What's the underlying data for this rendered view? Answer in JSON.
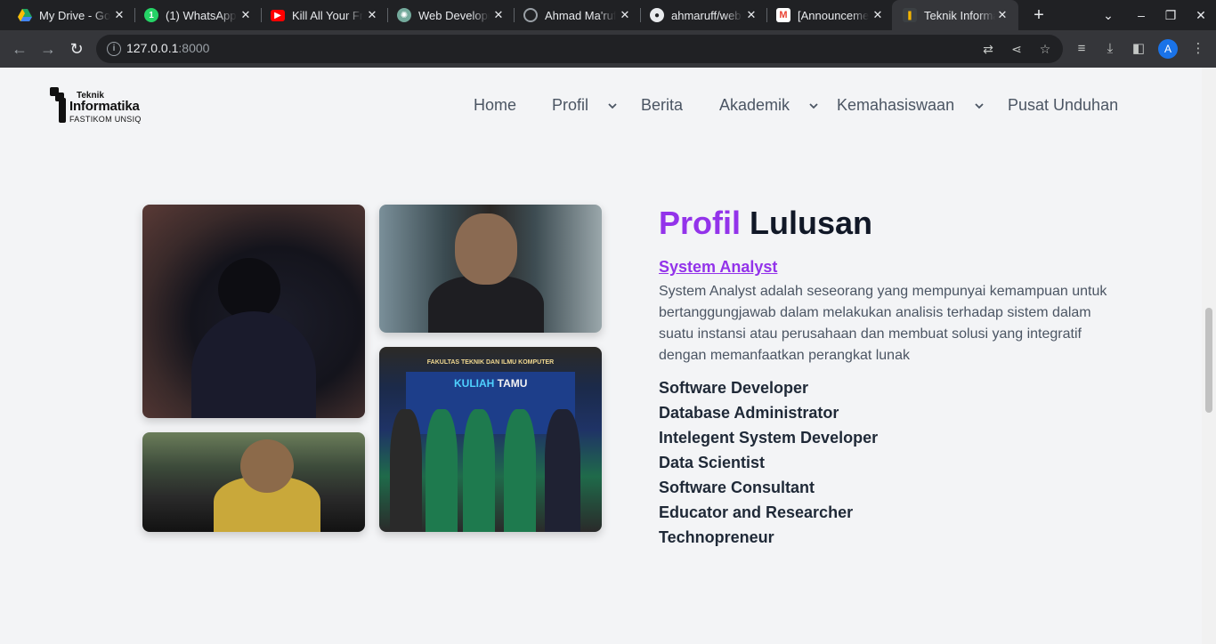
{
  "browser": {
    "tabs": [
      {
        "title": "My Drive - Google Drive",
        "icon": "google-drive-icon",
        "color": "#1fa463"
      },
      {
        "title": "(1) WhatsApp",
        "icon": "whatsapp-icon",
        "color": "#25d366"
      },
      {
        "title": "Kill All Your Friends",
        "icon": "youtube-icon",
        "color": "#ff0000"
      },
      {
        "title": "Web Development",
        "icon": "chatgpt-icon",
        "color": "#74aa9c"
      },
      {
        "title": "Ahmad Ma'ruf",
        "icon": "globe-icon",
        "color": "#9aa0a6"
      },
      {
        "title": "ahmaruff/website",
        "icon": "github-icon",
        "color": "#e8eaed"
      },
      {
        "title": "[Announcement]",
        "icon": "gmail-icon",
        "color": "#ea4335"
      },
      {
        "title": "Teknik Informatika",
        "icon": "site-icon",
        "color": "#f4b400"
      }
    ],
    "url_host": "127.0.0.1",
    "url_port": ":8000",
    "avatar_letter": "A"
  },
  "site": {
    "logo": {
      "line1": "Teknik",
      "line2": "Informatika",
      "line3": "FASTIKOM UNSIQ"
    },
    "nav": {
      "home": "Home",
      "profil": "Profil",
      "berita": "Berita",
      "akademik": "Akademik",
      "kemahasiswaan": "Kemahasiswaan",
      "unduhan": "Pusat Unduhan"
    }
  },
  "section": {
    "title_accent": "Profil",
    "title_rest": "Lulusan",
    "link": "System Analyst",
    "description": "System Analyst adalah seseorang yang mempunyai kemampuan untuk bertanggungjawab dalam melakukan analisis terhadap sistem dalam suatu instansi atau perusahaan dan membuat solusi yang integratif dengan memanfaatkan perangkat lunak",
    "careers": [
      "Software Developer",
      "Database Administrator",
      "Intelegent System Developer",
      "Data Scientist",
      "Software Consultant",
      "Educator and Researcher",
      "Technopreneur"
    ],
    "photo_banner": "FAKULTAS TEKNIK DAN ILMU KOMPUTER",
    "photo_kuliah": "KULIAH",
    "photo_tamu": "TAMU"
  },
  "colors": {
    "accent": "#9333ea",
    "heading": "#111827",
    "body_text": "#4b5563",
    "page_bg": "#f3f4f6"
  }
}
